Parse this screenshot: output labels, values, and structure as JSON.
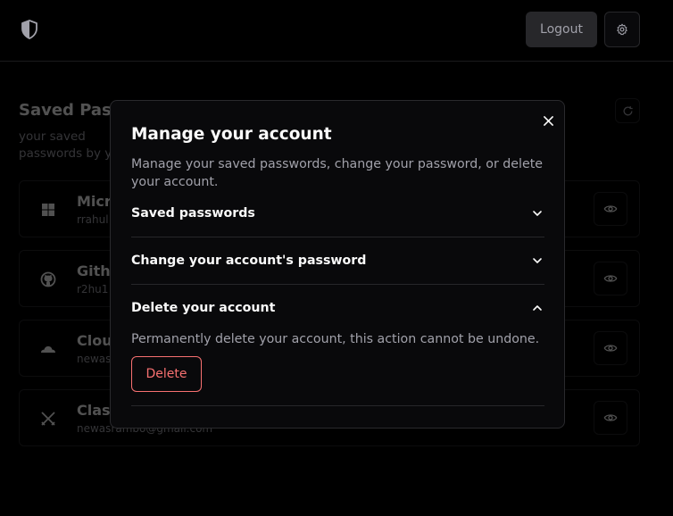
{
  "header": {
    "logo_icon": "shield-icon",
    "logout_label": "Logout",
    "settings_icon": "gear-icon"
  },
  "background": {
    "title": "Saved Passwords",
    "description": "your saved passwords by you.",
    "refresh_icon": "refresh-icon",
    "passwords": [
      {
        "icon": "windows-icon",
        "name": "Microsoft",
        "username": "rrahul"
      },
      {
        "icon": "github-icon",
        "name": "Github",
        "username": "r2hu1"
      },
      {
        "icon": "cloud-icon",
        "name": "Cloudflare",
        "username": "newas"
      },
      {
        "icon": "crossed-swords-icon",
        "name": "Clash",
        "username": "newasrambo@gmail.com"
      }
    ]
  },
  "modal": {
    "title": "Manage your account",
    "description": "Manage your saved passwords, change your password, or delete your account.",
    "close_icon": "close-icon",
    "sections": [
      {
        "label": "Saved passwords",
        "expanded": false
      },
      {
        "label": "Change your account's password",
        "expanded": false
      },
      {
        "label": "Delete your account",
        "expanded": true
      }
    ],
    "delete_text": "Permanently delete your account, this action cannot be undone.",
    "delete_button": "Delete"
  },
  "colors": {
    "background": "#000000",
    "surface": "#09090b",
    "border": "#27272a",
    "muted_text": "#a1a1aa",
    "destructive": "#f87171"
  }
}
